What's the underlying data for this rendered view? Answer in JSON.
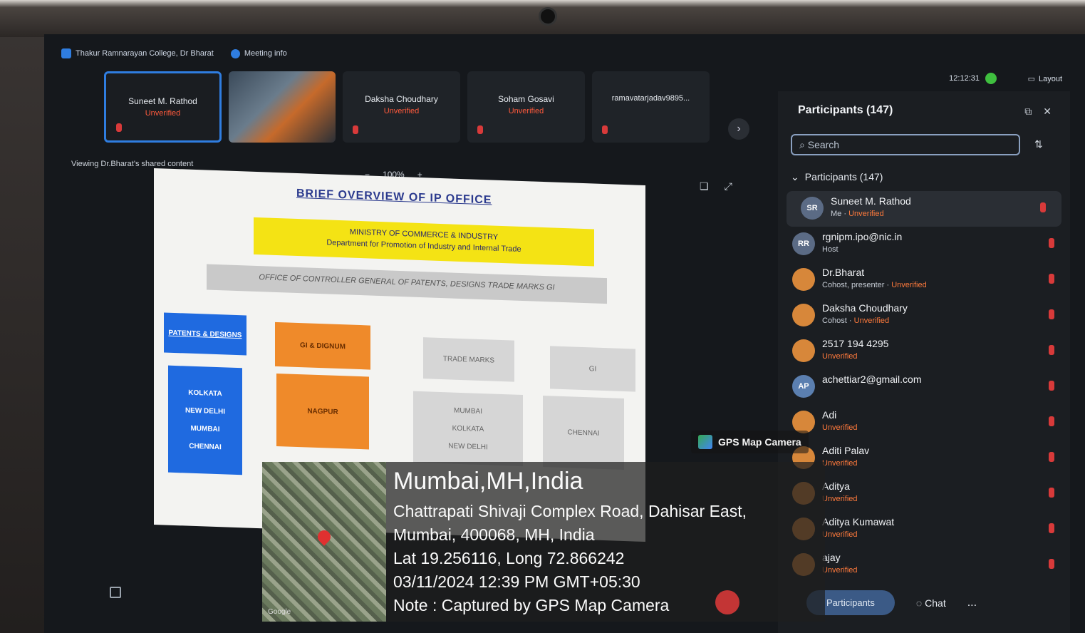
{
  "window": {
    "college": "Thakur Ramnarayan College, Dr Bharat",
    "meeting_info": "Meeting info",
    "clock": "12:12:31",
    "layout": "Layout"
  },
  "thumbs": [
    {
      "name": "Suneet M. Rathod",
      "status": "Unverified"
    },
    {
      "name": "",
      "status": ""
    },
    {
      "name": "Daksha Choudhary",
      "status": "Unverified"
    },
    {
      "name": "Soham Gosavi",
      "status": "Unverified"
    },
    {
      "name": "ramavatarjadav9895...",
      "status": ""
    }
  ],
  "share": {
    "viewing": "Viewing Dr.Bharat's shared content",
    "zoom_minus": "−",
    "zoom_value": "100%",
    "zoom_plus": "+"
  },
  "slide": {
    "title": "BRIEF OVERVIEW OF IP OFFICE",
    "ministry": "MINISTRY OF COMMERCE & INDUSTRY",
    "department": "Department for Promotion of Industry and Internal Trade",
    "controller": "OFFICE OF CONTROLLER GENERAL OF PATENTS, DESIGNS TRADE MARKS GI",
    "patents": "PATENTS & DESIGNS",
    "cities_patents": [
      "KOLKATA",
      "NEW DELHI",
      "MUMBAI",
      "CHENNAI"
    ],
    "gi": "GI & DIGNUM",
    "nagpur": "NAGPUR",
    "trademarks": "TRADE MARKS",
    "cities_tm": [
      "MUMBAI",
      "KOLKATA",
      "NEW DELHI"
    ],
    "gi2": "GI",
    "chennai": "CHENNAI"
  },
  "participants": {
    "title": "Participants (147)",
    "search_placeholder": "Search",
    "group": "Participants (147)",
    "list": [
      {
        "initials": "SR",
        "name": "Suneet M. Rathod",
        "role": "Me · ",
        "status": "Unverified",
        "color": "#5b6b85"
      },
      {
        "initials": "RR",
        "name": "rgnipm.ipo@nic.in",
        "role": "Host",
        "status": "",
        "color": "#5b6b85"
      },
      {
        "initials": "",
        "name": "Dr.Bharat",
        "role": "Cohost, presenter · ",
        "status": "Unverified",
        "color": "#d7873a"
      },
      {
        "initials": "",
        "name": "Daksha Choudhary",
        "role": "Cohost · ",
        "status": "Unverified",
        "color": "#d7873a"
      },
      {
        "initials": "",
        "name": "2517 194 4295",
        "role": "",
        "status": "Unverified",
        "color": "#d7873a"
      },
      {
        "initials": "AP",
        "name": "achettiar2@gmail.com",
        "role": "",
        "status": "",
        "color": "#5b7fb0"
      },
      {
        "initials": "",
        "name": "Adi",
        "role": "",
        "status": "Unverified",
        "color": "#d7873a"
      },
      {
        "initials": "",
        "name": "Aditi Palav",
        "role": "",
        "status": "Unverified",
        "color": "#d7873a"
      },
      {
        "initials": "",
        "name": "Aditya",
        "role": "",
        "status": "Unverified",
        "color": "#d7873a"
      },
      {
        "initials": "",
        "name": "Aditya Kumawat",
        "role": "",
        "status": "Unverified",
        "color": "#d7873a"
      },
      {
        "initials": "",
        "name": "ajay",
        "role": "",
        "status": "Unverified",
        "color": "#d7873a"
      }
    ],
    "footer_btn": "Participants",
    "chat": "Chat",
    "more": "..."
  },
  "gps": {
    "app": "GPS Map Camera",
    "city": "Mumbai,MH,India",
    "address1": "Chattrapati Shivaji Complex Road, Dahisar East,",
    "address2": "Mumbai, 400068, MH, India",
    "coords": "Lat 19.256116, Long 72.866242",
    "datetime": "03/11/2024 12:39 PM GMT+05:30",
    "note": "Note : Captured by GPS Map Camera",
    "map_logo": "Google"
  },
  "icons": [
    "shield-icon",
    "info-icon",
    "camera-icon",
    "chevron-right-icon",
    "search-icon",
    "sort-icon",
    "popout-icon",
    "close-icon",
    "mic-muted-icon",
    "chat-icon",
    "map-pin-icon"
  ]
}
